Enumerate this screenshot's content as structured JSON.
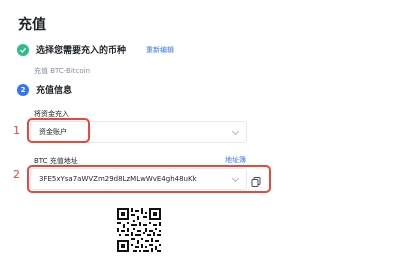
{
  "page": {
    "title": "充值"
  },
  "step1": {
    "title": "选择您需要充入的币种",
    "action": "重新编辑",
    "coin": "充值 BTC-Bitcoin"
  },
  "step2": {
    "number": "2",
    "title": "充值信息",
    "funding_label": "将资金充入",
    "funding_value": "资金账户",
    "address_label": "BTC 充值地址",
    "address_book": "地址簿",
    "address_value": "3FE5xYsa7aWVZm29d8LzMLwWvE4gh48uKk"
  },
  "annotations": {
    "first": "1",
    "second": "2"
  },
  "colors": {
    "accent": "#3375f6",
    "success": "#2ebd85",
    "highlight": "#e8473b"
  },
  "icons": [
    "check-icon",
    "chevron-down-icon",
    "copy-icon",
    "qr-code"
  ]
}
